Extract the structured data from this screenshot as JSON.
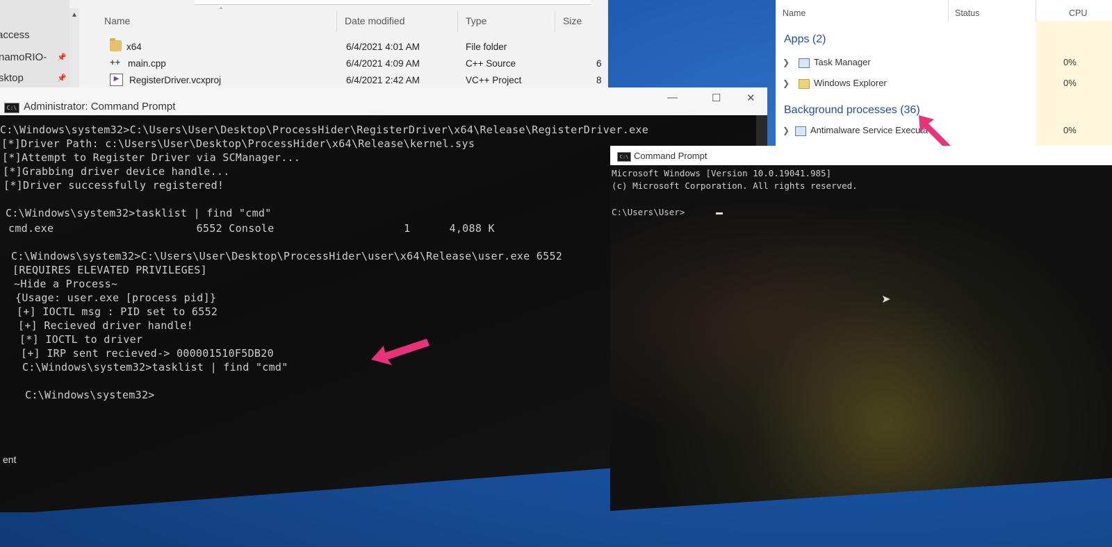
{
  "explorer": {
    "nav_items": [
      {
        "label": "access",
        "pinned": false
      },
      {
        "label": "namoRIO-",
        "pinned": true
      },
      {
        "label": "sktop",
        "pinned": true
      }
    ],
    "columns": {
      "name": "Name",
      "date": "Date modified",
      "type": "Type",
      "size": "Size"
    },
    "files": [
      {
        "name": "x64",
        "date": "6/4/2021 4:01 AM",
        "type": "File folder",
        "size": "",
        "icon": "folder-icon"
      },
      {
        "name": "main.cpp",
        "date": "6/4/2021 4:09 AM",
        "type": "C++ Source",
        "size": "6",
        "icon": "cpp-file-icon"
      },
      {
        "name": "RegisterDriver.vcxproj",
        "date": "6/4/2021 2:42 AM",
        "type": "VC++ Project",
        "size": "8",
        "icon": "vcxproj-file-icon"
      }
    ]
  },
  "task_manager": {
    "columns": {
      "name": "Name",
      "status": "Status",
      "cpu": "CPU"
    },
    "apps_header": "Apps (2)",
    "apps": [
      {
        "name": "Task Manager",
        "cpu": "0%"
      },
      {
        "name": "Windows Explorer",
        "cpu": "0%"
      }
    ],
    "background_header": "Background processes (36)",
    "background": [
      {
        "name": "Antimalware Service Executa",
        "cpu": "0%"
      }
    ]
  },
  "admin_cmd": {
    "title": "Administrator: Command Prompt",
    "icon_text": "C:\\",
    "lines": [
      "C:\\Windows\\system32>C:\\Users\\User\\Desktop\\ProcessHider\\RegisterDriver\\x64\\Release\\RegisterDriver.exe",
      "[*]Driver Path: c:\\Users\\User\\Desktop\\ProcessHider\\x64\\Release\\kernel.sys",
      "[*]Attempt to Register Driver via SCManager...",
      "[*]Grabbing driver device handle...",
      "[*]Driver successfully registered!",
      "",
      "C:\\Windows\\system32>tasklist | find \"cmd\"",
      "cmd.exe                      6552 Console                    1      4,088 K",
      "",
      "C:\\Windows\\system32>C:\\Users\\User\\Desktop\\ProcessHider\\user\\x64\\Release\\user.exe 6552",
      "[REQUIRES ELEVATED PRIVILEGES]",
      "~Hide a Process~",
      "{Usage: user.exe [process pid]}",
      "[+] IOCTL msg : PID set to 6552",
      "[+] Recieved driver handle!",
      "[*] IOCTL to driver",
      "[+] IRP sent recieved-> 000001510F5DB20",
      "C:\\Windows\\system32>tasklist | find \"cmd\"",
      "",
      "C:\\Windows\\system32>"
    ]
  },
  "cmd2": {
    "title": "Command Prompt",
    "icon_text": "C:\\",
    "lines": [
      "Microsoft Windows [Version 10.0.19041.985]",
      "(c) Microsoft Corporation. All rights reserved.",
      "",
      "C:\\Users\\User>"
    ]
  },
  "colors": {
    "annotation_arrow": "#e8337a",
    "desktop": "#1d58ad",
    "console_bg": "#111111",
    "console_text": "#cfcfcf"
  }
}
